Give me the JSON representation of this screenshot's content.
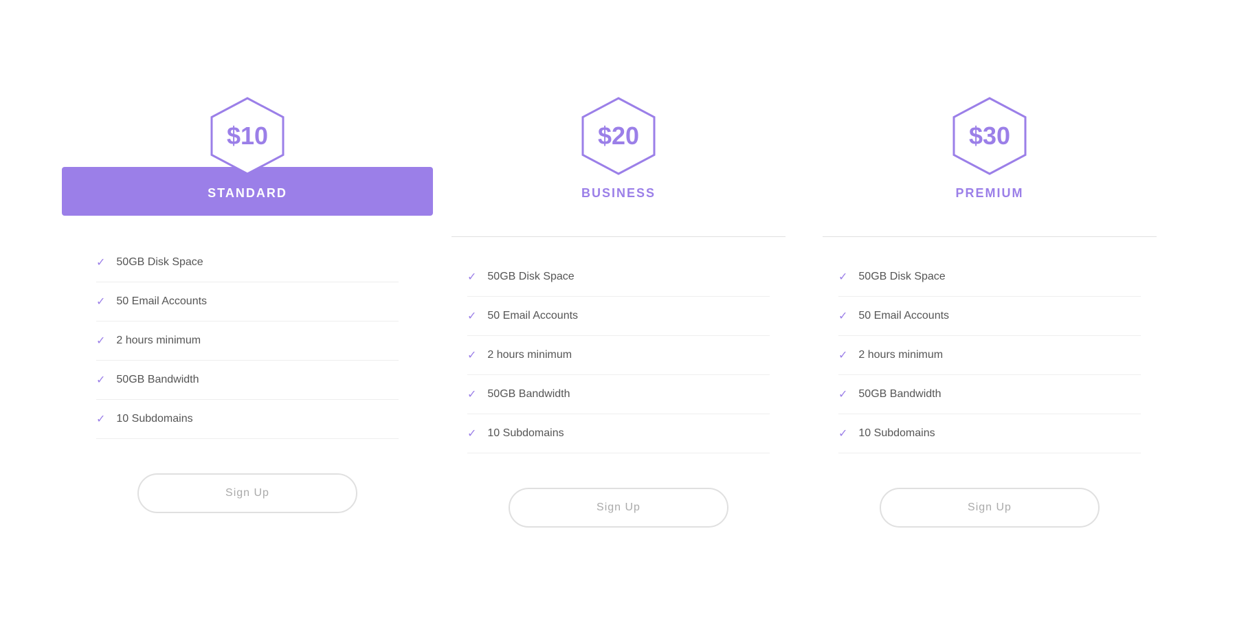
{
  "plans": [
    {
      "id": "standard",
      "price": "$10",
      "name": "STANDARD",
      "active": true,
      "features": [
        "50GB Disk Space",
        "50 Email Accounts",
        "2 hours minimum",
        "50GB Bandwidth",
        "10 Subdomains"
      ],
      "cta": "Sign Up"
    },
    {
      "id": "business",
      "price": "$20",
      "name": "BUSINESS",
      "active": false,
      "features": [
        "50GB Disk Space",
        "50 Email Accounts",
        "2 hours minimum",
        "50GB Bandwidth",
        "10 Subdomains"
      ],
      "cta": "Sign Up"
    },
    {
      "id": "premium",
      "price": "$30",
      "name": "PREMIUM",
      "active": false,
      "features": [
        "50GB Disk Space",
        "50 Email Accounts",
        "2 hours minimum",
        "50GB Bandwidth",
        "10 Subdomains"
      ],
      "cta": "Sign Up"
    }
  ],
  "colors": {
    "accent": "#9b7fe8",
    "active_bg": "#9b7fe8",
    "active_text": "#ffffff",
    "inactive_text": "#9b7fe8",
    "feature_text": "#555555",
    "divider": "#e0e0e0",
    "check": "#9b7fe8",
    "button_border": "#e0e0e0",
    "button_text": "#aaaaaa"
  }
}
